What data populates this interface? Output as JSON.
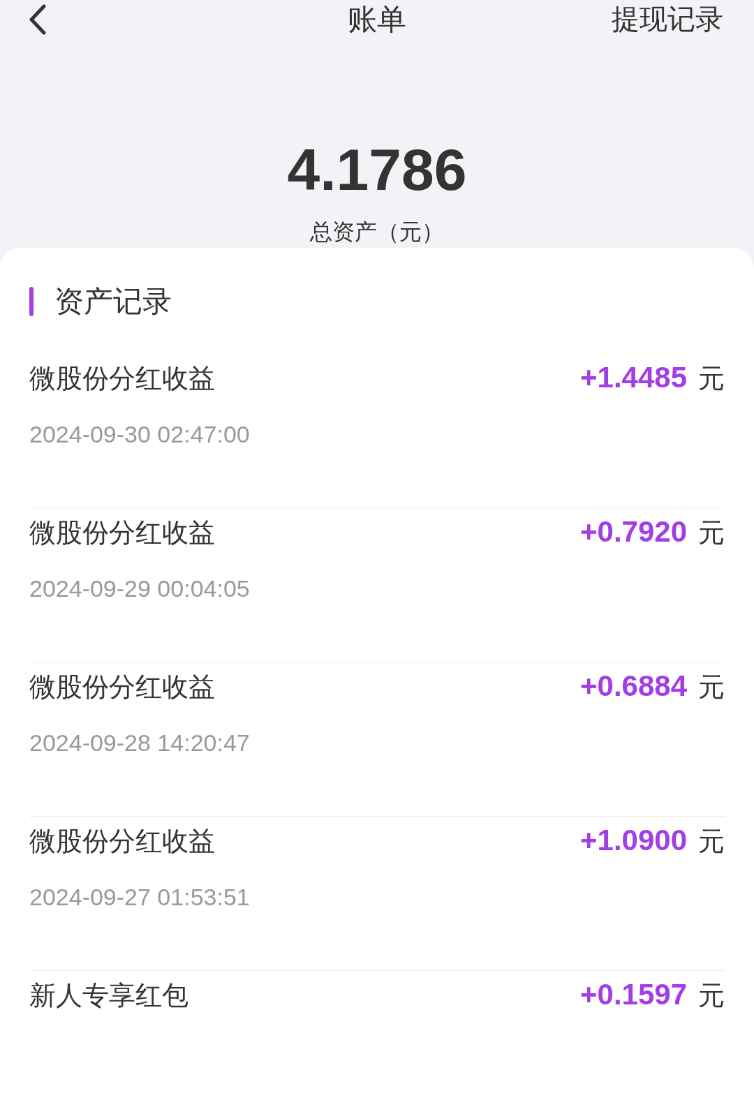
{
  "header": {
    "title": "账单",
    "action": "提现记录"
  },
  "balance": {
    "amount": "4.1786",
    "label": "总资产（元）"
  },
  "section": {
    "title": "资产记录"
  },
  "records": [
    {
      "name": "微股份分红收益",
      "amount": "+1.4485",
      "unit": "元",
      "time": "2024-09-30 02:47:00"
    },
    {
      "name": "微股份分红收益",
      "amount": "+0.7920",
      "unit": "元",
      "time": "2024-09-29 00:04:05"
    },
    {
      "name": "微股份分红收益",
      "amount": "+0.6884",
      "unit": "元",
      "time": "2024-09-28 14:20:47"
    },
    {
      "name": "微股份分红收益",
      "amount": "+1.0900",
      "unit": "元",
      "time": "2024-09-27 01:53:51"
    },
    {
      "name": "新人专享红包",
      "amount": "+0.1597",
      "unit": "元"
    }
  ]
}
